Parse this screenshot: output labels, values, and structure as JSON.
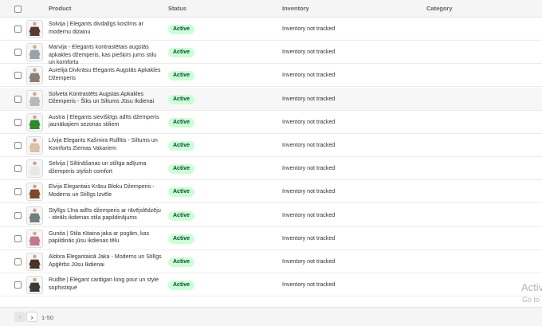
{
  "header": {
    "product": "Product",
    "status": "Status",
    "inventory": "Inventory",
    "category": "Category"
  },
  "rows": [
    {
      "title": "Solvija | Elegants divdaļīgs kostīms ar modernu dizainu",
      "status": "Active",
      "inventory": "Inventory not tracked",
      "color": "#5a3a2e"
    },
    {
      "title": "Marvija - Elegants kontrastētais augstās apkakles džemperis, kas piešķirs jums stilu un komfortu",
      "status": "Active",
      "inventory": "Inventory not tracked",
      "color": "#9aa3a8"
    },
    {
      "title": "Aurelija Divkrāsu Elegants Augstās Apkakles Džemperis",
      "status": "Active",
      "inventory": "Inventory not tracked",
      "color": "#8c7f76"
    },
    {
      "title": "Solveta Kontrastēts Augstas Apkakles Džemperis - Šiks un Siltums Jūsu Ikdienai",
      "status": "Active",
      "inventory": "Inventory not tracked",
      "color": "#b8b8b8"
    },
    {
      "title": "Austra | Elegants sievišķīgs adīts džemperis jaunākajiem sezonas stiliem",
      "status": "Active",
      "inventory": "Inventory not tracked",
      "color": "#2f8a2a"
    },
    {
      "title": "Līvija Elegants Kašmira Rullītis - Siltums un Komforts Ziemas Vakariem",
      "status": "Active",
      "inventory": "Inventory not tracked",
      "color": "#d9c2a8"
    },
    {
      "title": "Selvija | Siltināšanas un stilīga adījuma džemperis stylish comfort",
      "status": "Active",
      "inventory": "Inventory not tracked",
      "color": "#e8e8e8"
    },
    {
      "title": "Elvija Elegantais Krāsu Bloku Džemperis - Moderns un Stilīgs Izvēle",
      "status": "Active",
      "inventory": "Inventory not tracked",
      "color": "#7a4a2a"
    },
    {
      "title": "Stylīgs Līna adīts džemperis ar rāvējslēdzēju - ideāls ikdienas stila papildinājums",
      "status": "Active",
      "inventory": "Inventory not tracked",
      "color": "#6f7e78"
    },
    {
      "title": "Gunita | Stila rūtaina jaka ar pogām, kas papildinās jūsu ikdienas tēlu",
      "status": "Active",
      "inventory": "Inventory not tracked",
      "color": "#c07a8a"
    },
    {
      "title": "Aldora Elegantaisā Jaka - Moderns un Stilīgs Apģērbs Jūsu Ikdienai",
      "status": "Active",
      "inventory": "Inventory not tracked",
      "color": "#4a3328"
    },
    {
      "title": "Rudīte | Elégant cardigan long pour un style sophistiqué",
      "status": "Active",
      "inventory": "Inventory not tracked",
      "color": "#3a3a3a"
    }
  ],
  "pagination": {
    "prev_icon": "‹",
    "next_icon": "›",
    "range": "1-50"
  },
  "watermark": {
    "title": "Activ",
    "subtitle": "Go to"
  }
}
